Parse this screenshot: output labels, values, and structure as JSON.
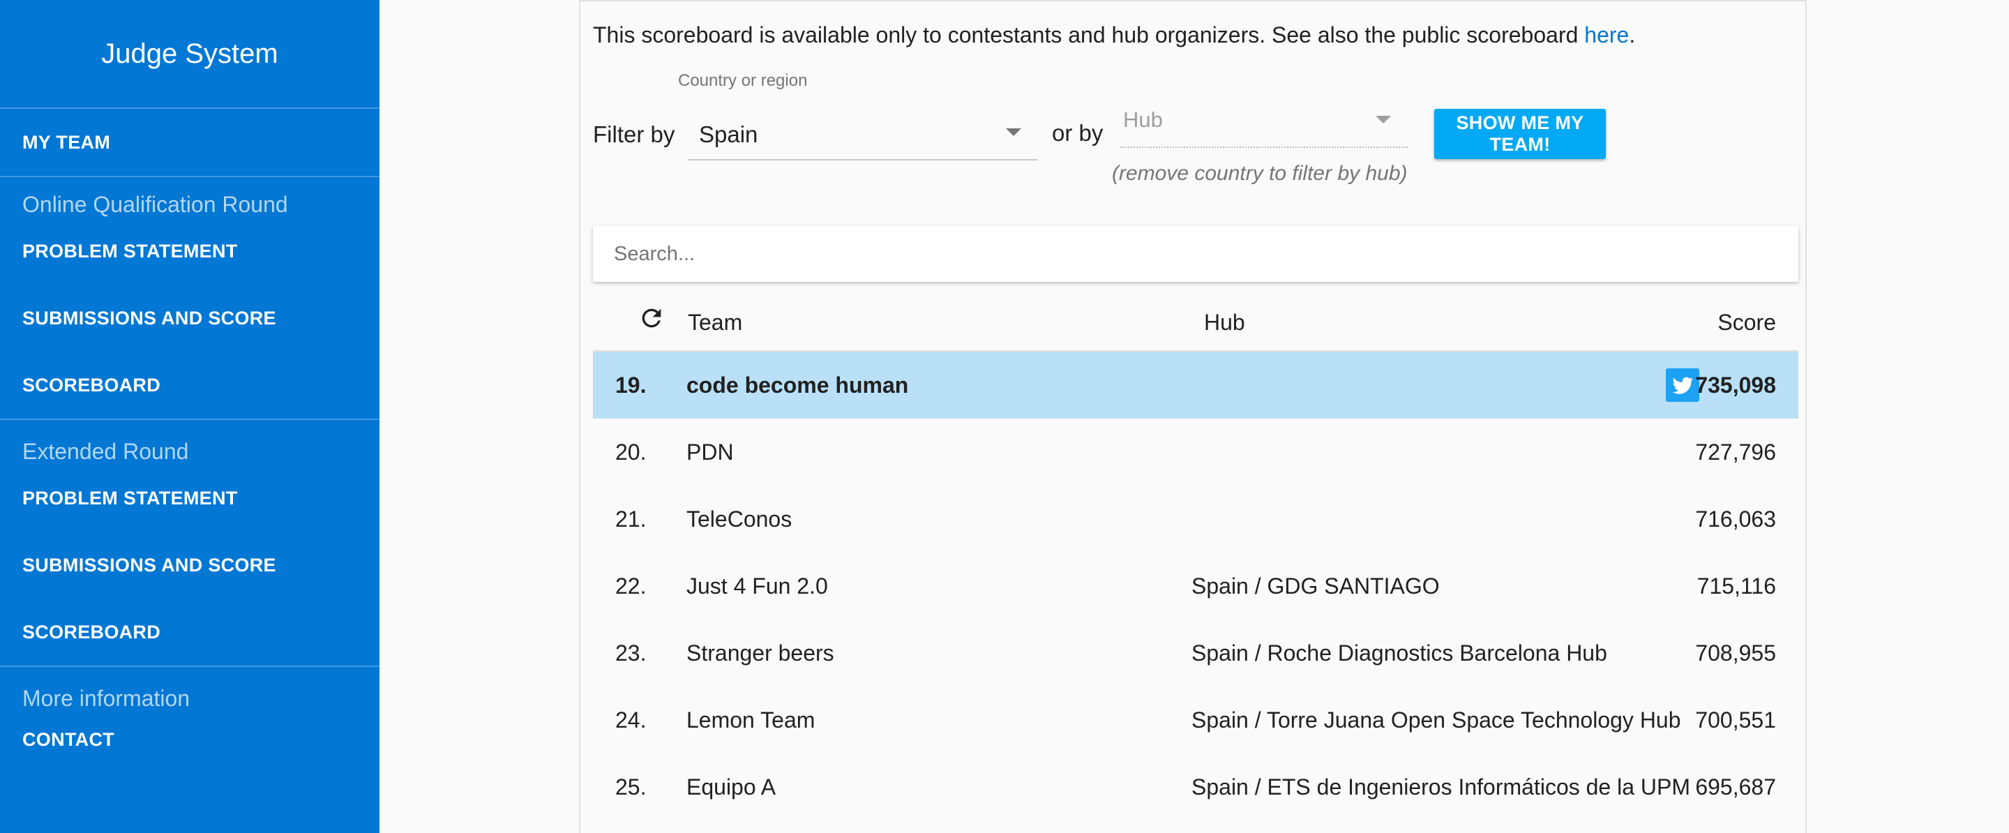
{
  "sidebar": {
    "app_title": "Judge System",
    "my_team": "MY TEAM",
    "sections": [
      {
        "title": "Online Qualification Round",
        "items": [
          "PROBLEM STATEMENT",
          "SUBMISSIONS AND SCORE",
          "SCOREBOARD"
        ]
      },
      {
        "title": "Extended Round",
        "items": [
          "PROBLEM STATEMENT",
          "SUBMISSIONS AND SCORE",
          "SCOREBOARD"
        ]
      },
      {
        "title": "More information",
        "items": [
          "CONTACT"
        ]
      }
    ]
  },
  "notice": {
    "text": "This scoreboard is available only to contestants and hub organizers. See also the public scoreboard ",
    "link": "here",
    "suffix": "."
  },
  "filter": {
    "label": "Filter by",
    "country_caption": "Country or region",
    "country_value": "Spain",
    "or_by": "or by",
    "hub_placeholder": "Hub",
    "hub_hint": "(remove country to filter by hub)",
    "my_team_button": "SHOW ME MY TEAM!"
  },
  "search": {
    "placeholder": "Search..."
  },
  "table": {
    "headers": {
      "team": "Team",
      "hub": "Hub",
      "score": "Score"
    },
    "rows": [
      {
        "rank": "19.",
        "team": "code become human",
        "hub": "",
        "score": "735,098"
      },
      {
        "rank": "20.",
        "team": "PDN",
        "hub": "",
        "score": "727,796"
      },
      {
        "rank": "21.",
        "team": "TeleConos",
        "hub": "",
        "score": "716,063"
      },
      {
        "rank": "22.",
        "team": "Just 4 Fun 2.0",
        "hub": "Spain / GDG SANTIAGO",
        "score": "715,116"
      },
      {
        "rank": "23.",
        "team": "Stranger beers",
        "hub": "Spain / Roche Diagnostics Barcelona Hub",
        "score": "708,955"
      },
      {
        "rank": "24.",
        "team": "Lemon Team",
        "hub": "Spain / Torre Juana Open Space Technology Hub",
        "score": "700,551"
      },
      {
        "rank": "25.",
        "team": "Equipo A",
        "hub": "Spain / ETS de Ingenieros Informáticos de la UPM",
        "score": "695,687"
      }
    ]
  },
  "colors": {
    "sidebar": "#0277d4",
    "button": "#03a9f4",
    "highlight_row": "#b9e0f7",
    "twitter": "#1da1f2"
  },
  "icons": {
    "refresh": "refresh-icon",
    "twitter": "twitter-icon",
    "dropdown": "caret-down-icon"
  }
}
